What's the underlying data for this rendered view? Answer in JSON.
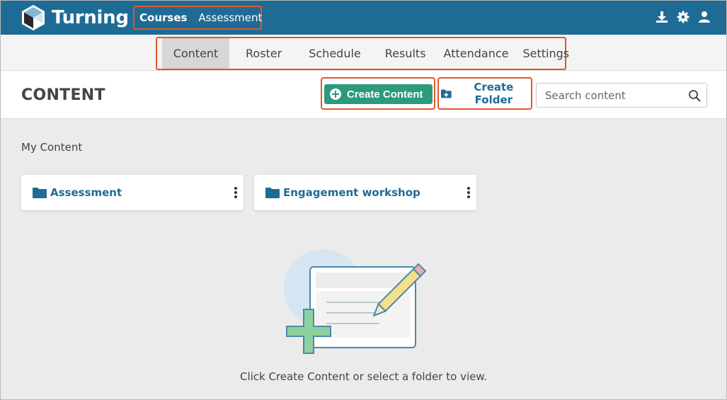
{
  "app": {
    "name": "Turning",
    "breadcrumb": {
      "courses": "Courses",
      "current": "Assessment"
    }
  },
  "nav": {
    "tabs": [
      {
        "label": "Content",
        "active": true
      },
      {
        "label": "Roster"
      },
      {
        "label": "Schedule"
      },
      {
        "label": "Results"
      },
      {
        "label": "Attendance"
      },
      {
        "label": "Settings"
      }
    ]
  },
  "header": {
    "title": "CONTENT",
    "create_content_label": "Create Content",
    "create_folder_label": "Create Folder",
    "search_placeholder": "Search content"
  },
  "content": {
    "section_label": "My Content",
    "folders": [
      {
        "name": "Assessment"
      },
      {
        "name": "Engagement workshop"
      }
    ],
    "empty_message": "Click Create Content or select a folder to view."
  },
  "colors": {
    "brand_blue": "#1e6c96",
    "create_green": "#2c9a7d",
    "highlight_orange": "#e2572b"
  },
  "icons": {
    "logo": "turning-cube-logo",
    "top_right": [
      "download-icon",
      "gear-icon",
      "user-icon"
    ],
    "search": "search-icon",
    "folder": "folder-icon",
    "more": "vertical-dots-icon"
  }
}
